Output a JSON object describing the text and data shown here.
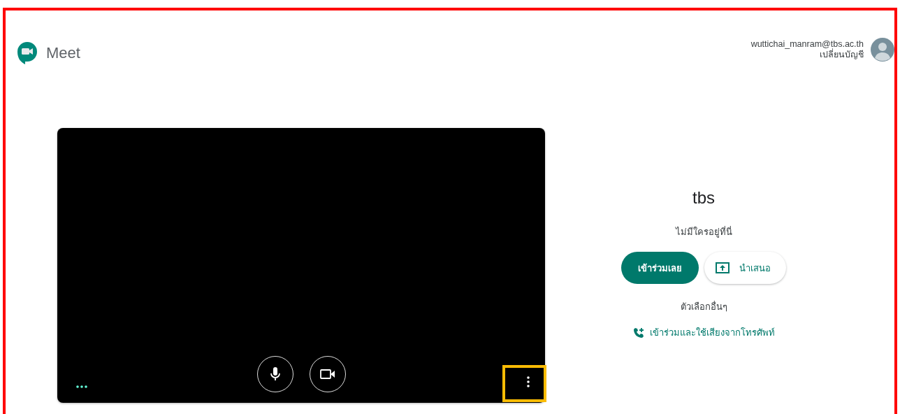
{
  "header": {
    "app_name": "Meet",
    "account": {
      "email": "wuttichai_manram@tbs.ac.th",
      "switch_label": "เปลี่ยนบัญชี"
    }
  },
  "meeting": {
    "title": "tbs",
    "status": "ไม่มีใครอยู่ที่นี่",
    "join_button": "เข้าร่วมเลย",
    "present_button": "นำเสนอ",
    "other_options_label": "ตัวเลือกอื่นๆ",
    "phone_option": "เข้าร่วมและใช้เสียงจากโทรศัพท์"
  }
}
